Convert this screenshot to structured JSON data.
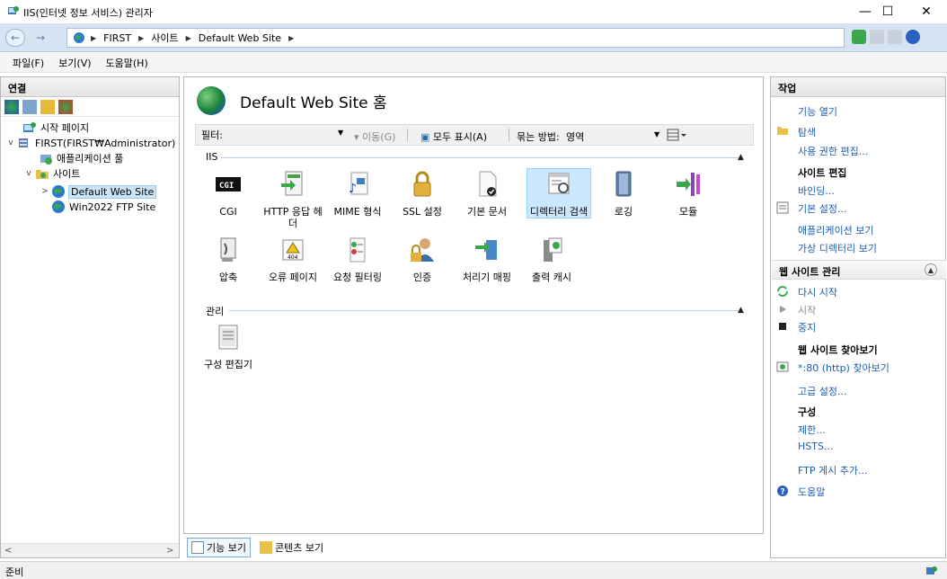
{
  "window": {
    "title": "IIS(인터넷 정보 서비스) 관리자",
    "minimize": "—",
    "maximize": "☐",
    "close": "✕"
  },
  "address": {
    "back": "←",
    "forward": "→",
    "segments": [
      "FIRST",
      "사이트",
      "Default Web Site"
    ]
  },
  "menu": {
    "items": [
      "파일(F)",
      "보기(V)",
      "도움말(H)"
    ]
  },
  "connections": {
    "header": "연결",
    "tree": {
      "start_page": "시작 페이지",
      "server": "FIRST(FIRST₩Administrator)",
      "app_pools": "애플리케이션 풀",
      "sites": "사이트",
      "default_site": "Default Web Site",
      "ftp_site": "Win2022 FTP Site"
    }
  },
  "center": {
    "title": "Default Web Site 홈",
    "filter": {
      "label": "필터:",
      "go": "이동(G)",
      "show_all": "모두 표시(A)",
      "group_by_label": "묶는 방법:",
      "group_by_value": "영역"
    },
    "groups": {
      "iis": "IIS",
      "management": "관리"
    },
    "features_row1": [
      "CGI",
      "HTTP 응답 헤더",
      "MIME 형식",
      "SSL 설정",
      "기본 문서",
      "디렉터리 검색",
      "로깅",
      "모듈"
    ],
    "features_row2": [
      "압축",
      "오류 페이지",
      "요청 필터링",
      "인증",
      "처리기 매핑",
      "출력 캐시"
    ],
    "features_mgmt": [
      "구성 편집기"
    ],
    "view_tabs": {
      "features": "기능 보기",
      "content": "콘텐츠 보기"
    }
  },
  "actions": {
    "header": "작업",
    "open_feature": "기능 열기",
    "explore": "탐색",
    "edit_permissions": "사용 권한 편집...",
    "edit_site_heading": "사이트 편집",
    "bindings": "바인딩...",
    "basic_settings": "기본 설정...",
    "view_apps": "애플리케이션 보기",
    "view_vdirs": "가상 디렉터리 보기",
    "manage_section": "웹 사이트 관리",
    "restart": "다시 시작",
    "start": "시작",
    "stop": "중지",
    "browse_heading": "웹 사이트 찾아보기",
    "browse_80": "*:80 (http) 찾아보기",
    "advanced": "고급 설정...",
    "config_heading": "구성",
    "limits": "제한...",
    "hsts": "HSTS...",
    "ftp_publish": "FTP 게시 추가...",
    "help": "도움말"
  },
  "status": {
    "text": "준비"
  },
  "colors": {
    "link": "#1a5fb4",
    "selection": "#cce8ff",
    "address_bar": "#d6e3f3"
  }
}
